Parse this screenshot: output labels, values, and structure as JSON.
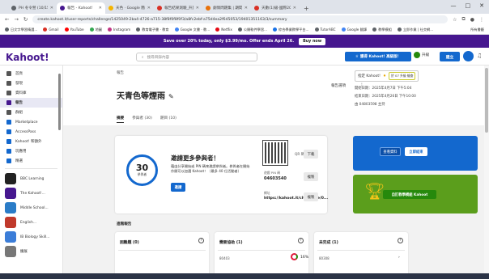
{
  "browser": {
    "tabs": [
      {
        "title": "PH 冬令營 (10/15) · 04/03/2025...",
        "color": "#5f6368",
        "active": false
      },
      {
        "title": "報告 - Kahoot!",
        "color": "#46178f",
        "active": true
      },
      {
        "title": "天色 · Google 簡報",
        "color": "#f4b400",
        "active": false
      },
      {
        "title": "報告結果測驗_升旗年級.pdf",
        "color": "#d93025",
        "active": false
      },
      {
        "title": "劇情問題集 | 期間回答",
        "color": "#e8710a",
        "active": false
      },
      {
        "title": "天數(1)級-國際2025年...",
        "color": "#d93025",
        "active": false
      }
    ],
    "new_tab": "+",
    "url": "create.kahoot.it/user-reports/challenge/1425049-2ba4-4726-a715-38f8f0f8f0f3/a8fc2ebf-a75d4ea2f645053/19401351163/3/summary",
    "window_controls": [
      "—",
      "□",
      "✕"
    ]
  },
  "bookmarks": [
    {
      "label": "日文字學習精選...",
      "color": "#5f6368"
    },
    {
      "label": "Gmail",
      "color": "#d93025"
    },
    {
      "label": "YouTube",
      "color": "#ff0000"
    },
    {
      "label": "地圖",
      "color": "#34a853"
    },
    {
      "label": "Instagram",
      "color": "#c13584"
    },
    {
      "label": "教育電子書 · 教育",
      "color": "#5f6368"
    },
    {
      "label": "Google 文書 · 教...",
      "color": "#4285f4"
    },
    {
      "label": "Netflix",
      "color": "#e50914"
    },
    {
      "label": "公開軟件學習...",
      "color": "#5f6368"
    },
    {
      "label": "綜合學業教學平台...",
      "color": "#1a73e8"
    },
    {
      "label": "TutorABC",
      "color": "#5f6368"
    },
    {
      "label": "Google 翻譯",
      "color": "#4285f4"
    },
    {
      "label": "教學模組",
      "color": "#5f6368"
    },
    {
      "label": "立即作業 | 社交網...",
      "color": "#5f6368"
    }
  ],
  "bookmarks_folder": "所有書籤",
  "promo": {
    "text": "Save over 20% today, only $3.99/mo. Offer ends April 26.",
    "button": "Buy now"
  },
  "header": {
    "logo": "Kahoot!",
    "search_placeholder": "搜尋目錄內容",
    "highlight_btn": "獲得 Kahoot! 高級版！",
    "upgrade": "升級",
    "create": "建立"
  },
  "sidebar": {
    "items": [
      {
        "label": "首頁",
        "color": "#555",
        "active": false
      },
      {
        "label": "發現",
        "color": "#555",
        "active": false
      },
      {
        "label": "資料庫",
        "color": "#555",
        "active": false
      },
      {
        "label": "報告",
        "color": "#46178f",
        "active": true
      },
      {
        "label": "群組",
        "color": "#555",
        "active": false
      },
      {
        "label": "Marketplace",
        "color": "#1368ce",
        "active": false
      },
      {
        "label": "AccessPass",
        "color": "#1368ce",
        "active": false
      },
      {
        "label": "Kahoot! 和額外",
        "color": "#1368ce",
        "active": false
      },
      {
        "label": "玩應用",
        "color": "#1368ce",
        "active": false
      },
      {
        "label": "精選",
        "color": "#1368ce",
        "active": false
      }
    ],
    "more_icon": "⌄",
    "groups": [
      {
        "label": "BBC Learning",
        "color": "#222"
      },
      {
        "label": "The Kahoot!...",
        "color": "#46178f"
      },
      {
        "label": "Middle School...",
        "color": "#2a7cc7"
      },
      {
        "label": "English...",
        "color": "#c0392b"
      },
      {
        "label": "IB Biology Skill...",
        "color": "#3b7dd8"
      },
      {
        "label": "擴展",
        "color": "#777"
      }
    ]
  },
  "report": {
    "label": "報告",
    "title": "天青色等煙雨",
    "options": "報告選項",
    "tabs": [
      {
        "label": "摘要",
        "active": true
      },
      {
        "label": "參與者 (30)",
        "active": false
      },
      {
        "label": "題目 (10)",
        "active": false
      }
    ],
    "live_label": "指定 Kahoot!",
    "live_badge": "於 07 升級 檢查",
    "created": "開始日期：2025年4月7日 下午5:04",
    "ended": "結束日期：2025年4月26日 下午10:00",
    "host": "由 04803598 主持"
  },
  "invite": {
    "count": "30",
    "count_label": "參與者",
    "title": "邀請更多參與者！",
    "desc": "藉由分享開始或 PIN 碼來邀請參與者。參與者在開始作開可以加選 Kahoot！（最多 40 位活動者）",
    "button": "邀請",
    "qr_label": "QR 碼",
    "download": "下載",
    "pin_label": "遊戲 PIN 碼",
    "pin": "04603540",
    "link_label": "網址",
    "link": "https://kahoot.it/challenge/0...",
    "copy": "複製"
  },
  "side_cards": {
    "btn_a": "查看資料",
    "btn_b": "立即結束",
    "btn_c": "自訂教學模組 Kahoot"
  },
  "section_title": "進階報告",
  "panels": [
    {
      "title": "困難題 (0)",
      "row_label": "",
      "value": ""
    },
    {
      "title": "需要協助 (1)",
      "row_label": "80403",
      "value": "16%"
    },
    {
      "title": "未完成 (1)",
      "row_label": "80308",
      "value": "›"
    }
  ],
  "colors": {
    "brand": "#46178f",
    "blue": "#1368ce",
    "green": "#26890c",
    "red": "#e21b3c"
  }
}
